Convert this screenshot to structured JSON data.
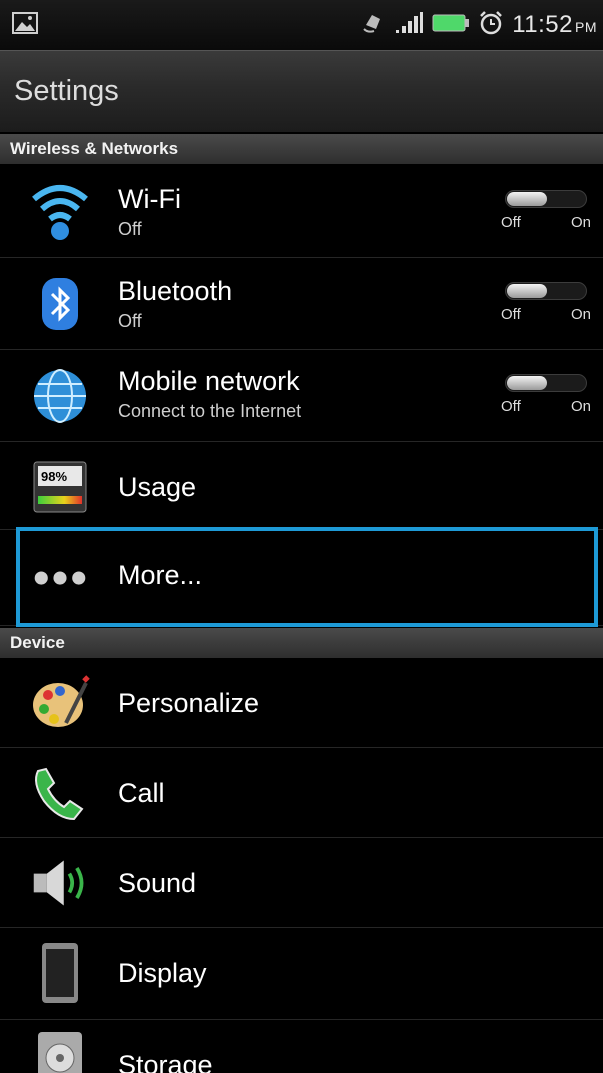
{
  "status_bar": {
    "time": "11:52",
    "ampm": "PM",
    "icons": [
      "image-notification-icon",
      "sync-icon",
      "signal-icon",
      "battery-icon",
      "alarm-icon"
    ]
  },
  "header": {
    "title": "Settings"
  },
  "sections": {
    "wireless": "Wireless & Networks",
    "device": "Device"
  },
  "items": {
    "wifi": {
      "label": "Wi-Fi",
      "sub": "Off",
      "toggle_off": "Off",
      "toggle_on": "On"
    },
    "bluetooth": {
      "label": "Bluetooth",
      "sub": "Off",
      "toggle_off": "Off",
      "toggle_on": "On"
    },
    "mobile": {
      "label": "Mobile network",
      "sub": "Connect to the Internet",
      "toggle_off": "Off",
      "toggle_on": "On"
    },
    "usage": {
      "label": "Usage",
      "meter_text": "98%"
    },
    "more": {
      "label": "More..."
    },
    "personalize": {
      "label": "Personalize"
    },
    "call": {
      "label": "Call"
    },
    "sound": {
      "label": "Sound"
    },
    "display": {
      "label": "Display"
    },
    "storage": {
      "label": "Storage"
    }
  },
  "colors": {
    "highlight": "#1e9ad6",
    "battery": "#4fd86a"
  }
}
